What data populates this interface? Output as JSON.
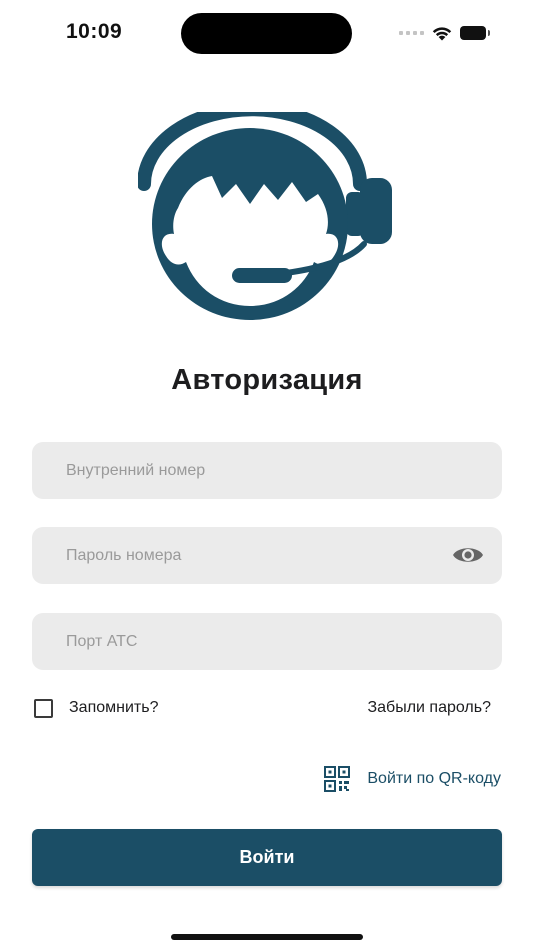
{
  "status_bar": {
    "time": "10:09",
    "icons": [
      "cellular-signal-icon",
      "wifi-icon",
      "battery-icon"
    ]
  },
  "logo": {
    "icon": "operator-headset-icon",
    "color": "#1b4e66"
  },
  "title": "Авторизация",
  "fields": {
    "extension": {
      "placeholder": "Внутренний номер",
      "value": ""
    },
    "password": {
      "placeholder": "Пароль номера",
      "value": "",
      "toggle_icon": "eye-icon"
    },
    "port": {
      "placeholder": "Порт АТС",
      "value": ""
    }
  },
  "remember": {
    "label": "Запомнить?",
    "checked": false
  },
  "forgot_password": "Забыли пароль?",
  "qr_login": {
    "icon": "qr-code-icon",
    "label": "Войти по QR-коду"
  },
  "login_button": "Войти",
  "colors": {
    "brand": "#1b4e66",
    "field_background": "#ebebeb",
    "placeholder": "#9a9a9a",
    "text": "#1d1d1f"
  }
}
